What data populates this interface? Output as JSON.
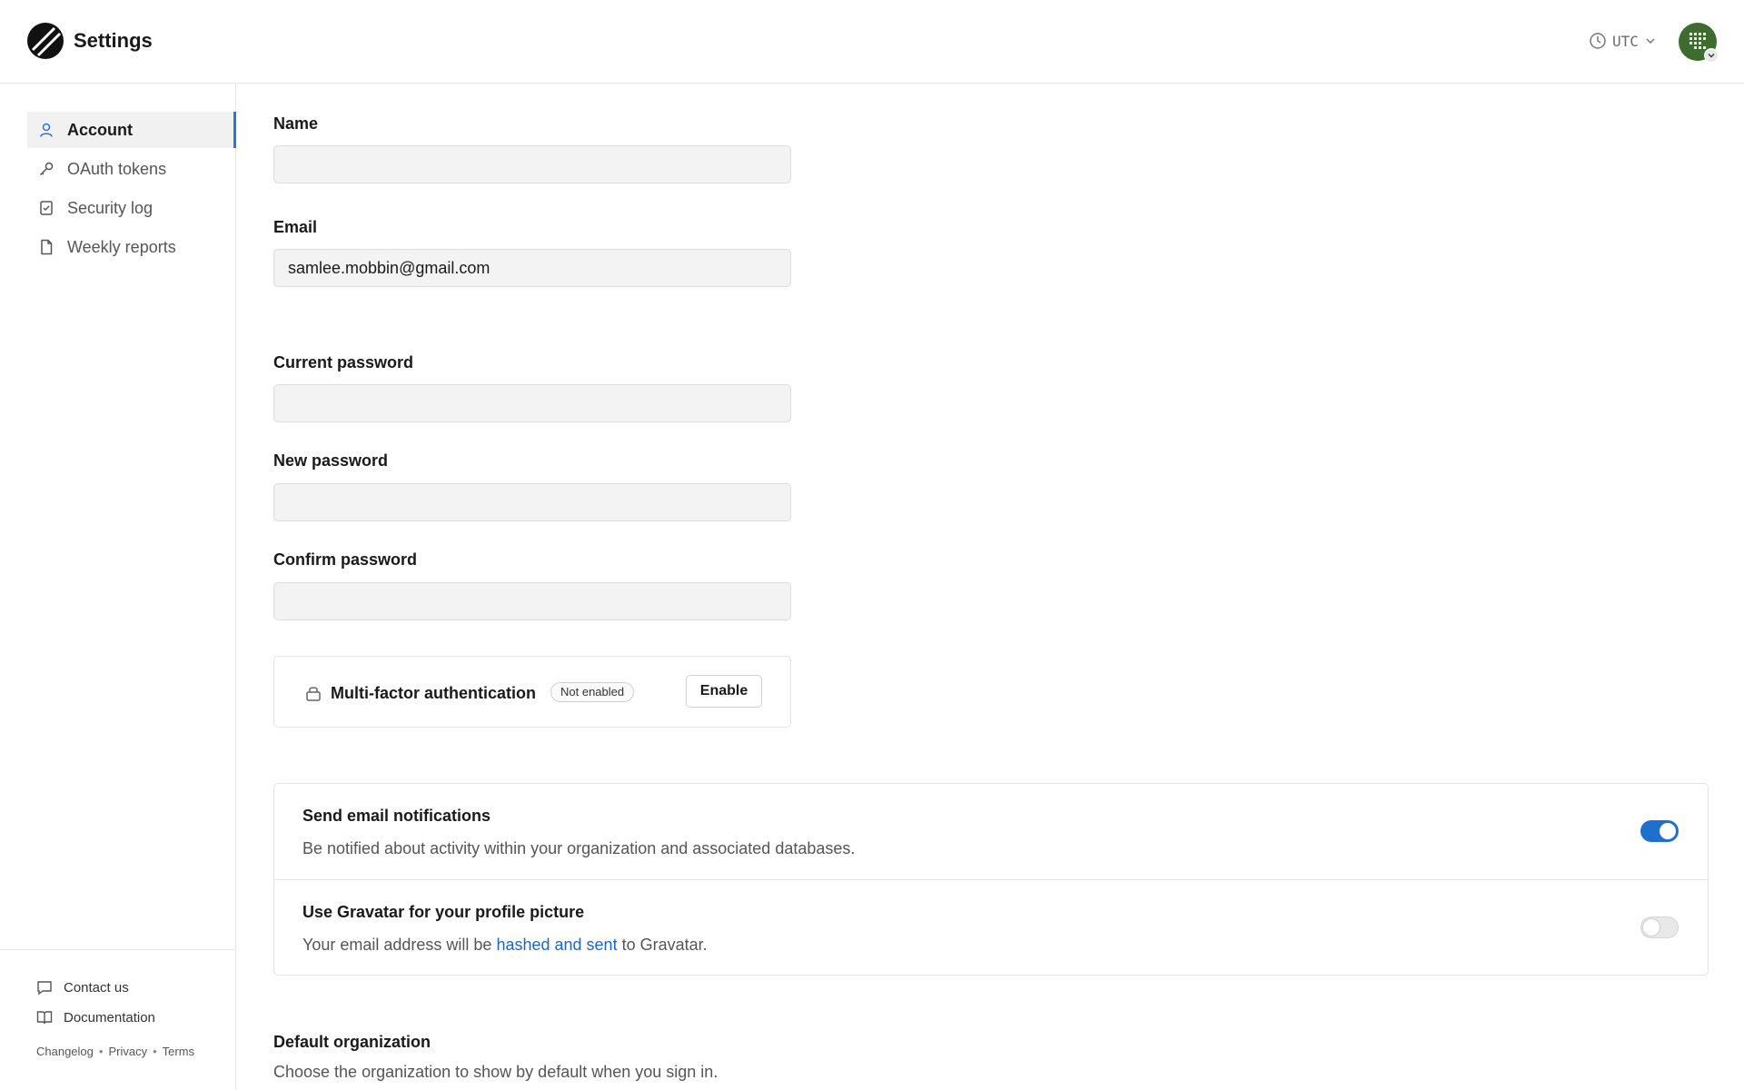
{
  "app": {
    "title": "Settings"
  },
  "header": {
    "timezone": "UTC"
  },
  "sidebar": {
    "items": [
      {
        "label": "Account",
        "icon": "user-icon",
        "active": true
      },
      {
        "label": "OAuth tokens",
        "icon": "key-icon",
        "active": false
      },
      {
        "label": "Security log",
        "icon": "checklist-icon",
        "active": false
      },
      {
        "label": "Weekly reports",
        "icon": "document-icon",
        "active": false
      }
    ],
    "footer": {
      "contact": "Contact us",
      "docs": "Documentation",
      "changelog": "Changelog",
      "privacy": "Privacy",
      "terms": "Terms",
      "separator": "•"
    }
  },
  "form": {
    "name_label": "Name",
    "name_value": "",
    "email_label": "Email",
    "email_value": "samlee.mobbin@gmail.com",
    "current_password_label": "Current password",
    "new_password_label": "New password",
    "confirm_password_label": "Confirm password"
  },
  "mfa": {
    "title": "Multi-factor authentication",
    "status": "Not enabled",
    "button": "Enable"
  },
  "preferences": [
    {
      "title": "Send email notifications",
      "description": "Be notified about activity within your organization and associated databases.",
      "enabled": true
    },
    {
      "title": "Use Gravatar for your profile picture",
      "description_prefix": "Your email address will be ",
      "description_link": "hashed and sent",
      "description_suffix": " to Gravatar.",
      "enabled": false
    }
  ],
  "default_org": {
    "title": "Default organization",
    "description": "Choose the organization to show by default when you sign in."
  },
  "colors": {
    "accent": "#1f6fcf",
    "link": "#2266b8",
    "avatar": "#3e6b2e"
  }
}
